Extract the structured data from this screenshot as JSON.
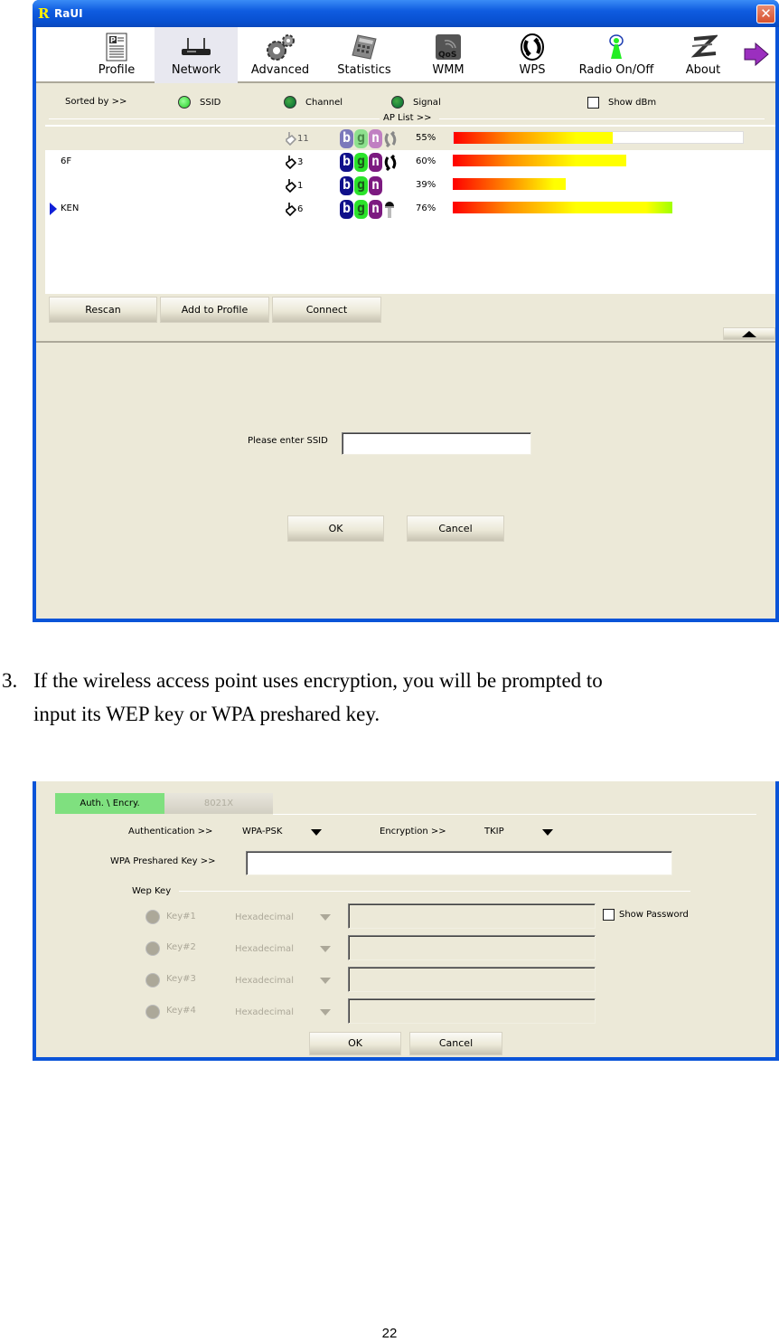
{
  "window1": {
    "title": "RaUI",
    "logo": "R",
    "toolbar": [
      {
        "label": "Profile",
        "icon": "profile-icon",
        "selected": false
      },
      {
        "label": "Network",
        "icon": "network-router-icon",
        "selected": true
      },
      {
        "label": "Advanced",
        "icon": "gears-icon",
        "selected": false
      },
      {
        "label": "Statistics",
        "icon": "calculator-icon",
        "selected": false
      },
      {
        "label": "WMM",
        "icon": "qos-icon",
        "selected": false
      },
      {
        "label": "WPS",
        "icon": "wps-icon",
        "selected": false
      },
      {
        "label": "Radio On/Off",
        "icon": "radio-antenna-icon",
        "selected": false
      },
      {
        "label": "About",
        "icon": "about-logo-icon",
        "selected": false
      }
    ],
    "next_arrow": "arrow-right-icon",
    "sort": {
      "label": "Sorted by >>",
      "options": [
        {
          "label": "SSID",
          "selected": true
        },
        {
          "label": "Channel",
          "selected": false
        },
        {
          "label": "Signal",
          "selected": false
        }
      ],
      "show_dbm_label": "Show dBm",
      "show_dbm_checked": false
    },
    "ap_list_label": "AP List >>",
    "ap_list": [
      {
        "ssid": "",
        "channel": "11",
        "modes": [
          "b",
          "g",
          "n"
        ],
        "extra_icon": "wps-icon",
        "signal": "55%",
        "signal_value": 55,
        "highlighted": true,
        "connected": false
      },
      {
        "ssid": "6F",
        "channel": "3",
        "modes": [
          "b",
          "g",
          "n"
        ],
        "extra_icon": "wps-icon",
        "signal": "60%",
        "signal_value": 60,
        "highlighted": false,
        "connected": false
      },
      {
        "ssid": "",
        "channel": "1",
        "modes": [
          "b",
          "g",
          "n"
        ],
        "extra_icon": "",
        "signal": "39%",
        "signal_value": 39,
        "highlighted": false,
        "connected": false
      },
      {
        "ssid": "KEN",
        "channel": "6",
        "modes": [
          "b",
          "g",
          "n"
        ],
        "extra_icon": "key-icon",
        "signal": "76%",
        "signal_value": 76,
        "highlighted": false,
        "connected": true
      }
    ],
    "buttons": {
      "rescan": "Rescan",
      "add_to_profile": "Add to Profile",
      "connect": "Connect"
    },
    "ssid_prompt": {
      "label": "Please enter SSID",
      "value": ""
    },
    "dialog_buttons": {
      "ok": "OK",
      "cancel": "Cancel"
    }
  },
  "body_text": {
    "step_number": "3.",
    "line1": "If the wireless access point uses encryption, you will be prompted to",
    "line2": "input its WEP key or WPA preshared key."
  },
  "window2": {
    "tabs": [
      {
        "label": "Auth. \\ Encry.",
        "active": true
      },
      {
        "label": "8021X",
        "active": false
      }
    ],
    "authentication_label": "Authentication >>",
    "authentication_value": "WPA-PSK",
    "encryption_label": "Encryption >>",
    "encryption_value": "TKIP",
    "wpa_key_label": "WPA Preshared Key >>",
    "wpa_key_value": "",
    "wep_group_label": "Wep Key",
    "wep_keys": [
      {
        "label": "Key#1",
        "format": "Hexadecimal",
        "value": ""
      },
      {
        "label": "Key#2",
        "format": "Hexadecimal",
        "value": ""
      },
      {
        "label": "Key#3",
        "format": "Hexadecimal",
        "value": ""
      },
      {
        "label": "Key#4",
        "format": "Hexadecimal",
        "value": ""
      }
    ],
    "show_password_label": "Show Password",
    "show_password_checked": false,
    "buttons": {
      "ok": "OK",
      "cancel": "Cancel"
    }
  },
  "page_number": "22",
  "colors": {
    "xp_blue": "#0a54d8",
    "face": "#ece9d8",
    "active_tab": "#7fe07f",
    "signal_low": "#ff0000",
    "signal_mid": "#ffff00",
    "signal_high": "#a0ff00"
  }
}
